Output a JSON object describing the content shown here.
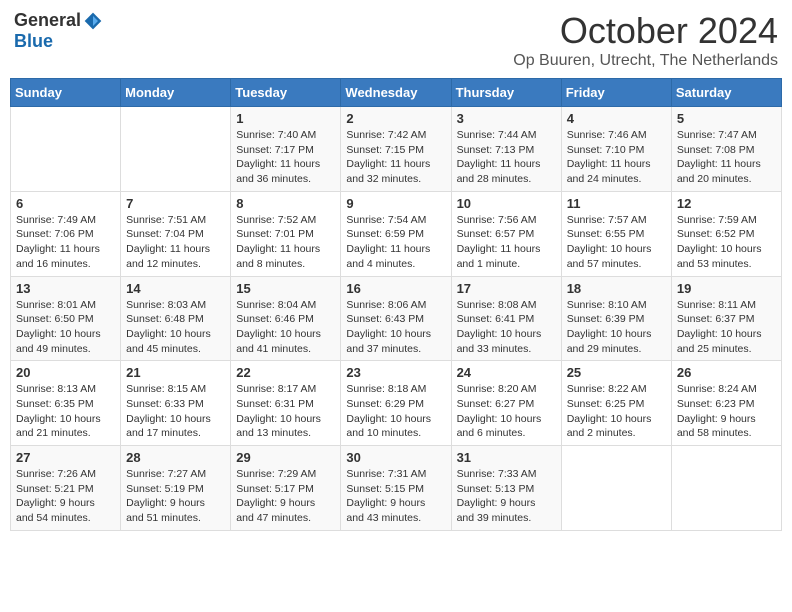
{
  "logo": {
    "general": "General",
    "blue": "Blue"
  },
  "title": "October 2024",
  "subtitle": "Op Buuren, Utrecht, The Netherlands",
  "days_of_week": [
    "Sunday",
    "Monday",
    "Tuesday",
    "Wednesday",
    "Thursday",
    "Friday",
    "Saturday"
  ],
  "weeks": [
    [
      {
        "day": "",
        "info": ""
      },
      {
        "day": "",
        "info": ""
      },
      {
        "day": "1",
        "info": "Sunrise: 7:40 AM\nSunset: 7:17 PM\nDaylight: 11 hours and 36 minutes."
      },
      {
        "day": "2",
        "info": "Sunrise: 7:42 AM\nSunset: 7:15 PM\nDaylight: 11 hours and 32 minutes."
      },
      {
        "day": "3",
        "info": "Sunrise: 7:44 AM\nSunset: 7:13 PM\nDaylight: 11 hours and 28 minutes."
      },
      {
        "day": "4",
        "info": "Sunrise: 7:46 AM\nSunset: 7:10 PM\nDaylight: 11 hours and 24 minutes."
      },
      {
        "day": "5",
        "info": "Sunrise: 7:47 AM\nSunset: 7:08 PM\nDaylight: 11 hours and 20 minutes."
      }
    ],
    [
      {
        "day": "6",
        "info": "Sunrise: 7:49 AM\nSunset: 7:06 PM\nDaylight: 11 hours and 16 minutes."
      },
      {
        "day": "7",
        "info": "Sunrise: 7:51 AM\nSunset: 7:04 PM\nDaylight: 11 hours and 12 minutes."
      },
      {
        "day": "8",
        "info": "Sunrise: 7:52 AM\nSunset: 7:01 PM\nDaylight: 11 hours and 8 minutes."
      },
      {
        "day": "9",
        "info": "Sunrise: 7:54 AM\nSunset: 6:59 PM\nDaylight: 11 hours and 4 minutes."
      },
      {
        "day": "10",
        "info": "Sunrise: 7:56 AM\nSunset: 6:57 PM\nDaylight: 11 hours and 1 minute."
      },
      {
        "day": "11",
        "info": "Sunrise: 7:57 AM\nSunset: 6:55 PM\nDaylight: 10 hours and 57 minutes."
      },
      {
        "day": "12",
        "info": "Sunrise: 7:59 AM\nSunset: 6:52 PM\nDaylight: 10 hours and 53 minutes."
      }
    ],
    [
      {
        "day": "13",
        "info": "Sunrise: 8:01 AM\nSunset: 6:50 PM\nDaylight: 10 hours and 49 minutes."
      },
      {
        "day": "14",
        "info": "Sunrise: 8:03 AM\nSunset: 6:48 PM\nDaylight: 10 hours and 45 minutes."
      },
      {
        "day": "15",
        "info": "Sunrise: 8:04 AM\nSunset: 6:46 PM\nDaylight: 10 hours and 41 minutes."
      },
      {
        "day": "16",
        "info": "Sunrise: 8:06 AM\nSunset: 6:43 PM\nDaylight: 10 hours and 37 minutes."
      },
      {
        "day": "17",
        "info": "Sunrise: 8:08 AM\nSunset: 6:41 PM\nDaylight: 10 hours and 33 minutes."
      },
      {
        "day": "18",
        "info": "Sunrise: 8:10 AM\nSunset: 6:39 PM\nDaylight: 10 hours and 29 minutes."
      },
      {
        "day": "19",
        "info": "Sunrise: 8:11 AM\nSunset: 6:37 PM\nDaylight: 10 hours and 25 minutes."
      }
    ],
    [
      {
        "day": "20",
        "info": "Sunrise: 8:13 AM\nSunset: 6:35 PM\nDaylight: 10 hours and 21 minutes."
      },
      {
        "day": "21",
        "info": "Sunrise: 8:15 AM\nSunset: 6:33 PM\nDaylight: 10 hours and 17 minutes."
      },
      {
        "day": "22",
        "info": "Sunrise: 8:17 AM\nSunset: 6:31 PM\nDaylight: 10 hours and 13 minutes."
      },
      {
        "day": "23",
        "info": "Sunrise: 8:18 AM\nSunset: 6:29 PM\nDaylight: 10 hours and 10 minutes."
      },
      {
        "day": "24",
        "info": "Sunrise: 8:20 AM\nSunset: 6:27 PM\nDaylight: 10 hours and 6 minutes."
      },
      {
        "day": "25",
        "info": "Sunrise: 8:22 AM\nSunset: 6:25 PM\nDaylight: 10 hours and 2 minutes."
      },
      {
        "day": "26",
        "info": "Sunrise: 8:24 AM\nSunset: 6:23 PM\nDaylight: 9 hours and 58 minutes."
      }
    ],
    [
      {
        "day": "27",
        "info": "Sunrise: 7:26 AM\nSunset: 5:21 PM\nDaylight: 9 hours and 54 minutes."
      },
      {
        "day": "28",
        "info": "Sunrise: 7:27 AM\nSunset: 5:19 PM\nDaylight: 9 hours and 51 minutes."
      },
      {
        "day": "29",
        "info": "Sunrise: 7:29 AM\nSunset: 5:17 PM\nDaylight: 9 hours and 47 minutes."
      },
      {
        "day": "30",
        "info": "Sunrise: 7:31 AM\nSunset: 5:15 PM\nDaylight: 9 hours and 43 minutes."
      },
      {
        "day": "31",
        "info": "Sunrise: 7:33 AM\nSunset: 5:13 PM\nDaylight: 9 hours and 39 minutes."
      },
      {
        "day": "",
        "info": ""
      },
      {
        "day": "",
        "info": ""
      }
    ]
  ]
}
